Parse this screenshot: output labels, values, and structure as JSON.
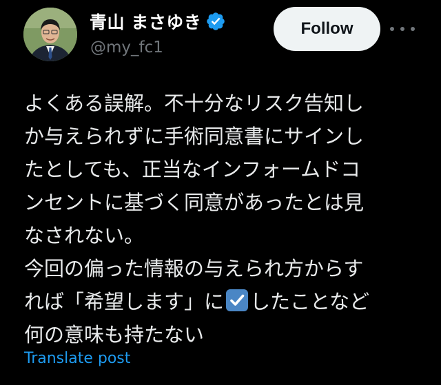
{
  "author": {
    "display_name": "青山 まさゆき",
    "handle": "@my_fc1",
    "verified": true,
    "verified_color": "#1d9bf0"
  },
  "actions": {
    "follow_label": "Follow"
  },
  "post": {
    "lines": [
      "よくある誤解。不十分なリスク告知し",
      "か与えられずに手術同意書にサインし",
      "たとしても、正当なインフォームドコ",
      "ンセントに基づく同意があったとは見",
      "なされない。",
      "今回の偏った情報の与えられ方からす",
      "れば「希望します」に",
      "したことなど",
      "何の意味も持たない"
    ],
    "emoji": "ballot-box-with-check"
  },
  "footer": {
    "translate_label": "Translate post"
  },
  "colors": {
    "background": "#000000",
    "text": "#e7e9ea",
    "muted": "#71767b",
    "link": "#1d9bf0",
    "button_bg": "#eff3f4"
  }
}
